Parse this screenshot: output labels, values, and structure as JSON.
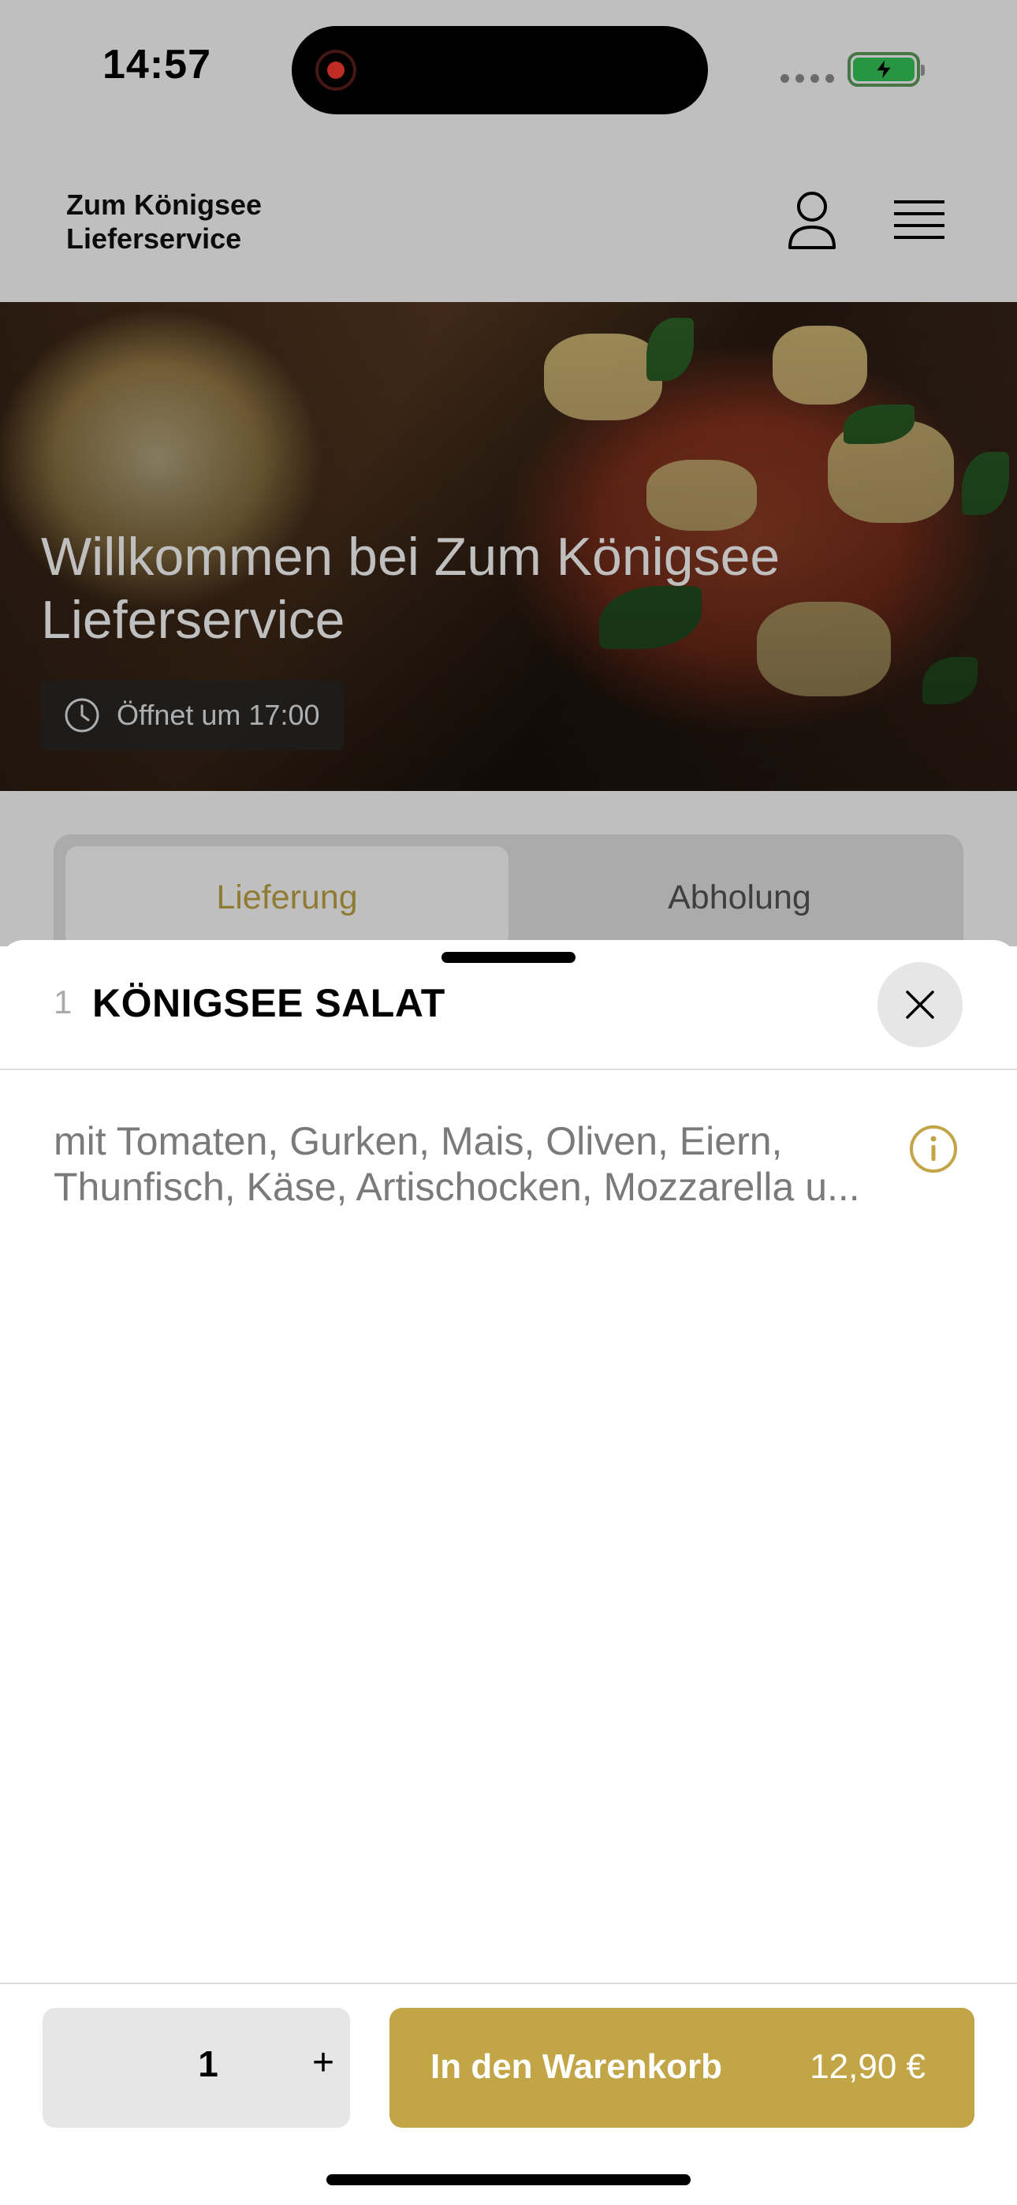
{
  "status_bar": {
    "time": "14:57"
  },
  "header": {
    "brand": "Zum Königsee Lieferservice"
  },
  "hero": {
    "title": "Willkommen bei Zum Königsee Lieferservice",
    "hours": "Öffnet um 17:00"
  },
  "tabs": [
    {
      "label": "Lieferung",
      "active": true
    },
    {
      "label": "Abholung",
      "active": false
    }
  ],
  "item": {
    "number": "1",
    "name": "KÖNIGSEE SALAT",
    "description": "mit Tomaten, Gurken, Mais, Oliven, Eiern, Thunfisch, Käse, Artischocken, Mozzarella u..."
  },
  "order": {
    "quantity": "1",
    "plus": "+",
    "cart_label": "In den Warenkorb",
    "price": "12,90 €"
  },
  "colors": {
    "accent": "#c1a547",
    "text_muted": "#7a7a7a",
    "control_bg": "#e6e6e6"
  },
  "icons": [
    "recording-icon",
    "battery-charging-icon",
    "user-icon",
    "menu-icon",
    "clock-icon",
    "close-icon",
    "info-icon"
  ]
}
